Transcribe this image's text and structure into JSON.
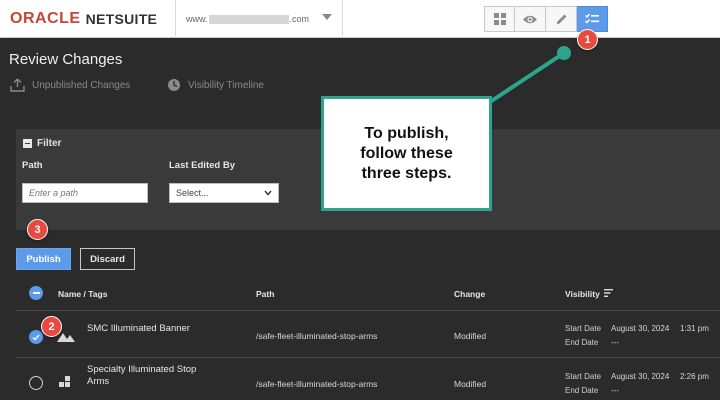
{
  "header": {
    "brand_primary": "ORACLE",
    "brand_secondary": "NETSUITE",
    "domain_prefix": "www.",
    "domain_suffix": ".com",
    "tools": [
      "grid-icon",
      "eye-icon",
      "pencil-icon",
      "review-changes-icon"
    ],
    "accent_color": "#5b9bea"
  },
  "page": {
    "title": "Review Changes",
    "tabs": [
      {
        "label": "Unpublished Changes",
        "icon": "upload-icon"
      },
      {
        "label": "Visibility Timeline",
        "icon": "clock-icon"
      }
    ]
  },
  "filter": {
    "toggle_label": "Filter",
    "path_label": "Path",
    "path_placeholder": "Enter a path",
    "last_edited_label": "Last Edited By",
    "last_edited_value": "Select..."
  },
  "actions": {
    "publish_label": "Publish",
    "discard_label": "Discard"
  },
  "table": {
    "columns": {
      "name": "Name / Tags",
      "path": "Path",
      "change": "Change",
      "visibility": "Visibility"
    },
    "start_label": "Start Date",
    "end_label": "End Date",
    "rows": [
      {
        "name": "SMC Illuminated Banner",
        "path": "/safe-fleet-illuminated-stop-arms",
        "change": "Modified",
        "start_date": "August 30, 2024",
        "start_time": "1:31 pm",
        "end_date": "---",
        "checked": true,
        "icon": "image-icon"
      },
      {
        "name_line1": "Specialty Illuminated Stop",
        "name_line2": "Arms",
        "path": "/safe-fleet-illuminated-stop-arms",
        "change": "Modified",
        "start_date": "August 30, 2024",
        "start_time": "2:26 pm",
        "end_date": "---",
        "checked": false,
        "icon": "blocks-icon"
      }
    ]
  },
  "callout": {
    "lines": [
      "To publish,",
      "follow these",
      "three steps."
    ],
    "border_color": "#2da58e"
  },
  "badges": [
    "1",
    "2",
    "3"
  ],
  "badge_color": "#e84a3f"
}
